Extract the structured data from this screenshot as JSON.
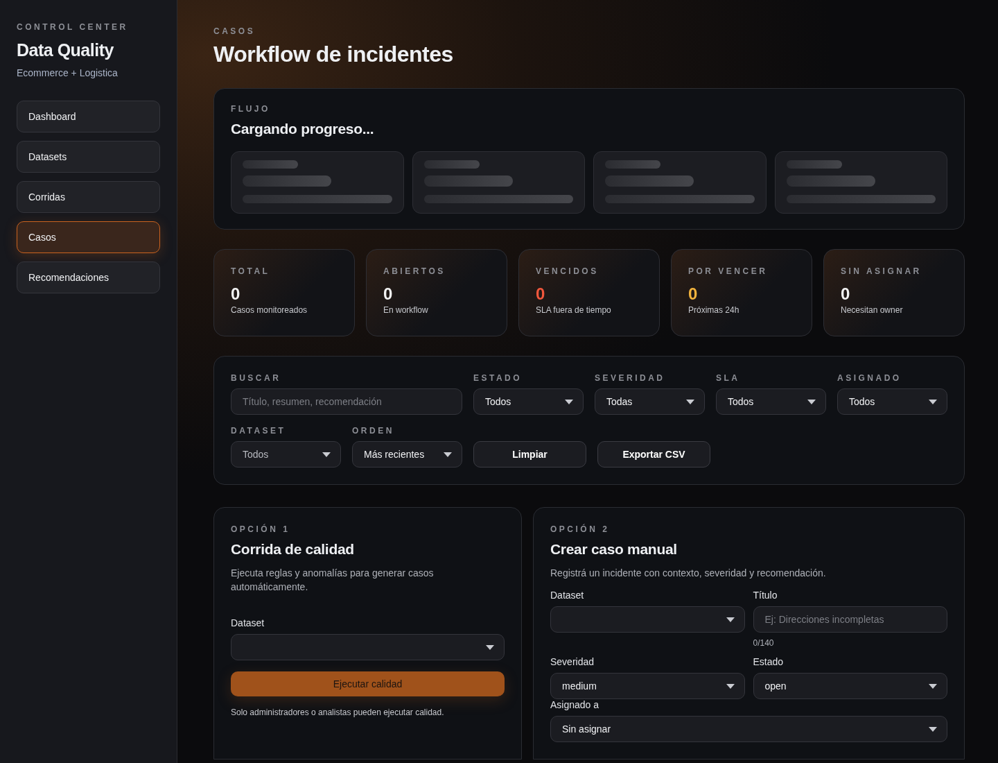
{
  "sidebar": {
    "eyebrow": "CONTROL CENTER",
    "title": "Data Quality",
    "subtitle": "Ecommerce + Logistica",
    "items": [
      {
        "label": "Dashboard",
        "selected": false
      },
      {
        "label": "Datasets",
        "selected": false
      },
      {
        "label": "Corridas",
        "selected": false
      },
      {
        "label": "Casos",
        "selected": true
      },
      {
        "label": "Recomendaciones",
        "selected": false
      }
    ]
  },
  "header": {
    "eyebrow": "CASOS",
    "title": "Workflow de incidentes"
  },
  "flow": {
    "eyebrow": "FLUJO",
    "title": "Cargando progreso...",
    "skeleton_cards": [
      {
        "kind": "skeleton"
      },
      {
        "kind": "skeleton"
      },
      {
        "kind": "skeleton"
      },
      {
        "kind": "skeleton"
      }
    ]
  },
  "stats": [
    {
      "label": "TOTAL",
      "value": "0",
      "caption": "Casos monitoreados",
      "color": "#f2f2f2"
    },
    {
      "label": "ABIERTOS",
      "value": "0",
      "caption": "En workflow",
      "color": "#f2f2f2"
    },
    {
      "label": "VENCIDOS",
      "value": "0",
      "caption": "SLA fuera de tiempo",
      "color": "#f0573c"
    },
    {
      "label": "POR VENCER",
      "value": "0",
      "caption": "Próximas 24h",
      "color": "#f2b33d"
    },
    {
      "label": "SIN ASIGNAR",
      "value": "0",
      "caption": "Necesitan owner",
      "color": "#f2f2f2"
    }
  ],
  "filters": {
    "search": {
      "label": "BUSCAR",
      "placeholder": "Título, resumen, recomendación"
    },
    "selects_row1": [
      {
        "label": "ESTADO",
        "value": "Todos"
      },
      {
        "label": "SEVERIDAD",
        "value": "Todas"
      },
      {
        "label": "SLA",
        "value": "Todos"
      },
      {
        "label": "ASIGNADO",
        "value": "Todos"
      }
    ],
    "selects_row2": [
      {
        "label": "DATASET",
        "value": "Todos",
        "muted": true
      },
      {
        "label": "ORDEN",
        "value": "Más recientes",
        "muted": false
      }
    ],
    "buttons": [
      "Limpiar",
      "Exportar CSV"
    ]
  },
  "option1": {
    "eyebrow": "OPCIÓN 1",
    "title": "Corrida de calidad",
    "description": "Ejecuta reglas y anomalías para generar casos automáticamente.",
    "dataset_label": "Dataset",
    "button": "Ejecutar calidad",
    "note": "Solo administradores o analistas pueden ejecutar calidad."
  },
  "option2": {
    "eyebrow": "OPCIÓN 2",
    "title": "Crear caso manual",
    "description": "Registrá un incidente con contexto, severidad y recomendación.",
    "dataset_label": "Dataset",
    "title_label": "Título",
    "title_placeholder": "Ej: Direcciones incompletas",
    "counter": "0/140",
    "severity_label": "Severidad",
    "severity_value": "medium",
    "status_label": "Estado",
    "status_value": "open",
    "assigned_label": "Asignado a",
    "assigned_value": "Sin asignar"
  }
}
